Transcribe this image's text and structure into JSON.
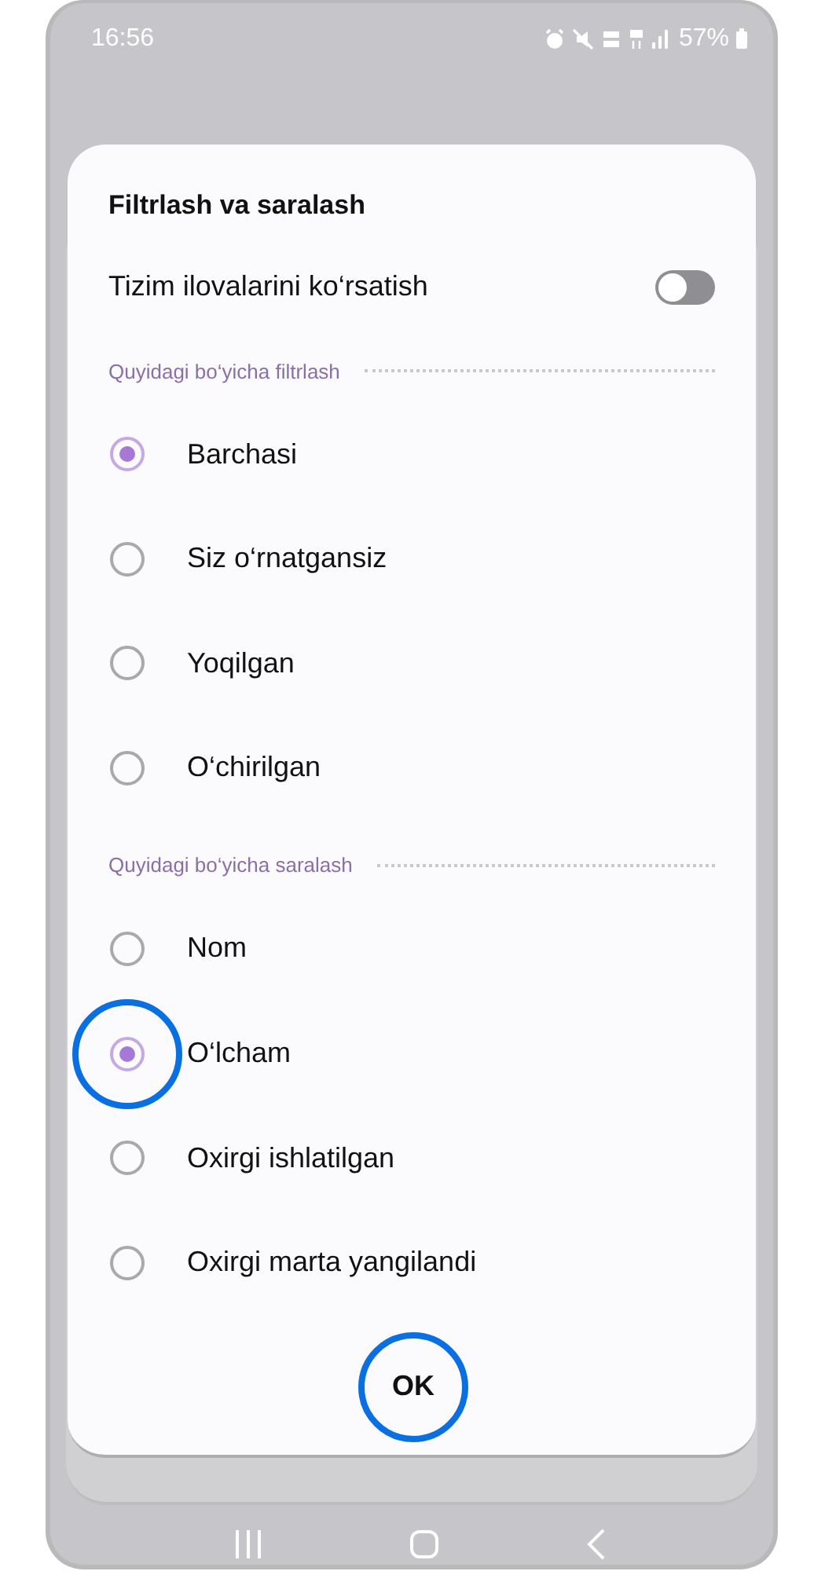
{
  "status_bar": {
    "time": "16:56",
    "battery": "57%"
  },
  "dialog": {
    "title": "Filtrlash va saralash",
    "toggle": {
      "label": "Tizim ilovalarini ko‘rsatish",
      "on": false
    },
    "sections": [
      {
        "title": "Quyidagi bo‘yicha filtrlash",
        "options": [
          {
            "label": "Barchasi",
            "selected": true
          },
          {
            "label": "Siz o‘rnatgansiz",
            "selected": false
          },
          {
            "label": "Yoqilgan",
            "selected": false
          },
          {
            "label": "O‘chirilgan",
            "selected": false
          }
        ]
      },
      {
        "title": "Quyidagi bo‘yicha saralash",
        "options": [
          {
            "label": "Nom",
            "selected": false
          },
          {
            "label": "O‘lcham",
            "selected": true,
            "highlighted": true
          },
          {
            "label": "Oxirgi ishlatilgan",
            "selected": false
          },
          {
            "label": "Oxirgi marta yangilandi",
            "selected": false
          }
        ]
      }
    ],
    "button": {
      "label": "OK",
      "highlighted": true
    }
  }
}
